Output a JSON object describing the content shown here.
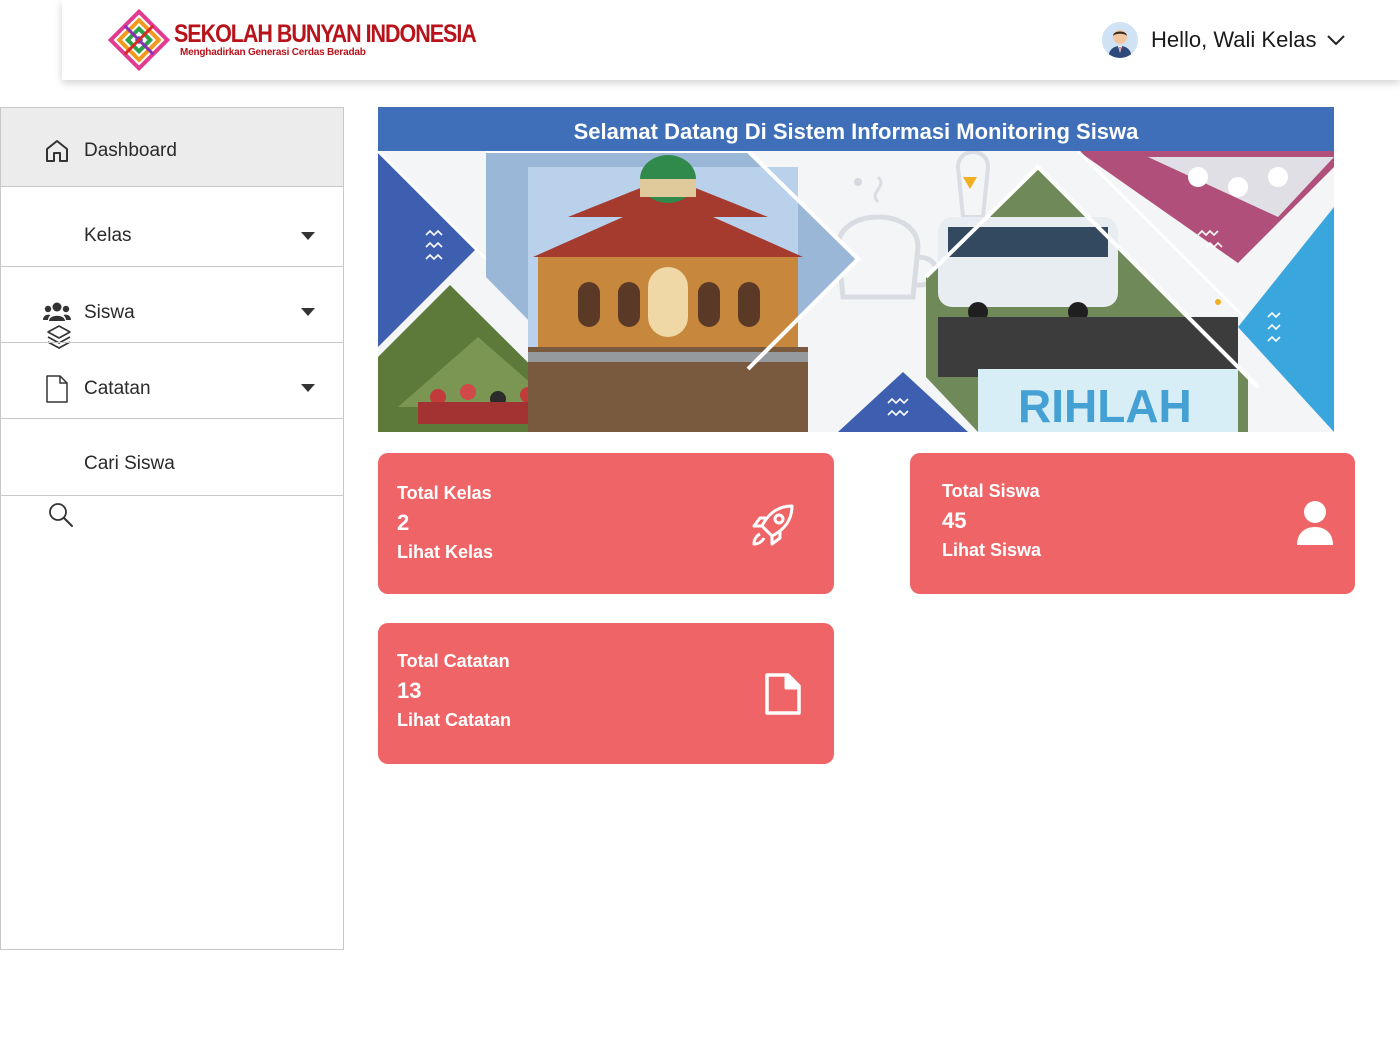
{
  "header": {
    "brand_name": "SEKOLAH BUNYAN INDONESIA",
    "brand_tagline": "Menghadirkan Generasi Cerdas Beradab",
    "greeting": "Hello, Wali Kelas"
  },
  "sidebar": {
    "items": [
      {
        "label": "Dashboard",
        "icon": "home-icon",
        "active": true
      },
      {
        "label": "Kelas",
        "icon": "layers-icon",
        "has_dropdown": true
      },
      {
        "label": "Siswa",
        "icon": "users-icon",
        "has_dropdown": true
      },
      {
        "label": "Catatan",
        "icon": "document-icon",
        "has_dropdown": true
      },
      {
        "label": "Cari Siswa",
        "icon": "search-icon"
      }
    ]
  },
  "banner": {
    "title": "Selamat Datang Di Sistem Informasi Monitoring Siswa",
    "photo_caption": "RIHLAH"
  },
  "cards": [
    {
      "title": "Total Kelas",
      "value": "2",
      "link": "Lihat Kelas",
      "icon": "rocket-icon"
    },
    {
      "title": "Total Siswa",
      "value": "45",
      "link": "Lihat Siswa",
      "icon": "user-icon"
    },
    {
      "title": "Total Catatan",
      "value": "13",
      "link": "Lihat Catatan",
      "icon": "file-icon"
    }
  ],
  "colors": {
    "card_background": "#ef6567",
    "banner_title_bar": "#3e6fb8",
    "brand_red": "#b8121b",
    "active_nav_background": "#ececec"
  }
}
